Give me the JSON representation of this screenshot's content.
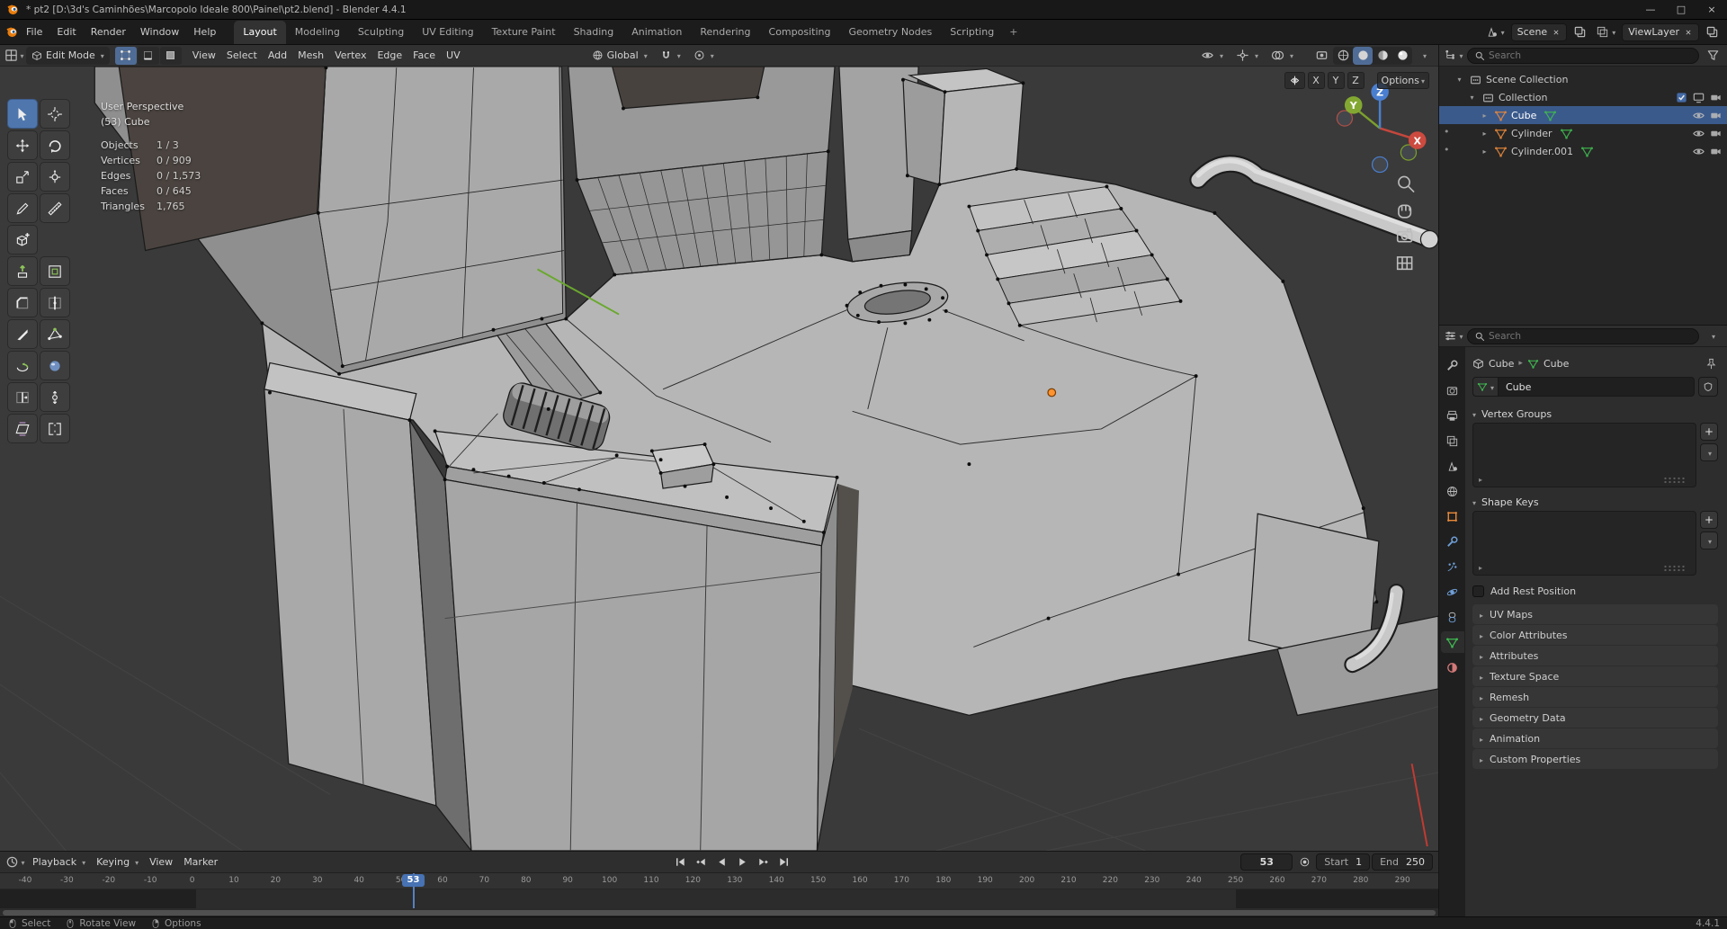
{
  "window": {
    "title": "* pt2 [D:\\3d's Caminhões\\Marcopolo Ideale 800\\Painel\\pt2.blend] - Blender 4.4.1"
  },
  "colors": {
    "accent": "#4772b3",
    "selection_row": "#3b5a8c",
    "object_orange": "#e8883a",
    "mesh_green": "#3fb950",
    "axis_x": "#c4473d",
    "axis_y": "#6fa21c",
    "axis_z": "#3d6fd2"
  },
  "topbar": {
    "menus": [
      {
        "label": "File"
      },
      {
        "label": "Edit"
      },
      {
        "label": "Render"
      },
      {
        "label": "Window"
      },
      {
        "label": "Help"
      }
    ],
    "workspaces": [
      {
        "label": "Layout",
        "active": true
      },
      {
        "label": "Modeling"
      },
      {
        "label": "Sculpting"
      },
      {
        "label": "UV Editing"
      },
      {
        "label": "Texture Paint"
      },
      {
        "label": "Shading"
      },
      {
        "label": "Animation"
      },
      {
        "label": "Rendering"
      },
      {
        "label": "Compositing"
      },
      {
        "label": "Geometry Nodes"
      },
      {
        "label": "Scripting"
      }
    ],
    "add_tab": "+",
    "scene": {
      "value": "Scene"
    },
    "viewlayer": {
      "value": "ViewLayer"
    }
  },
  "viewport": {
    "header": {
      "mode": "Edit Mode",
      "menus": [
        {
          "label": "View"
        },
        {
          "label": "Select"
        },
        {
          "label": "Add"
        },
        {
          "label": "Mesh"
        },
        {
          "label": "Vertex"
        },
        {
          "label": "Edge"
        },
        {
          "label": "Face"
        },
        {
          "label": "UV"
        }
      ],
      "orientation": "Global"
    },
    "overlay_region": {
      "mirror_x": "X",
      "mirror_y": "Y",
      "mirror_z": "Z",
      "options": "Options"
    },
    "text_overlay": {
      "perspective": "User Perspective",
      "active_object": "(53) Cube",
      "stats": [
        {
          "label": "Objects",
          "value": "1 / 3"
        },
        {
          "label": "Vertices",
          "value": "0 / 909"
        },
        {
          "label": "Edges",
          "value": "0 / 1,573"
        },
        {
          "label": "Faces",
          "value": "0 / 645"
        },
        {
          "label": "Triangles",
          "value": "1,765"
        }
      ]
    },
    "toolbar": [
      {
        "name": "tweak",
        "icon": "tool-tweak",
        "active": true
      },
      {
        "name": "cursor",
        "icon": "tool-cursor"
      },
      {
        "name": "move",
        "icon": "tool-move"
      },
      {
        "name": "rotate",
        "icon": "tool-rotate"
      },
      {
        "name": "scale",
        "icon": "tool-scale"
      },
      {
        "name": "transform",
        "icon": "tool-transform"
      },
      {
        "name": "annotate",
        "icon": "tool-annotate"
      },
      {
        "name": "measure",
        "icon": "tool-measure"
      },
      {
        "name": "add-cube",
        "icon": "tool-addcube"
      },
      {
        "empty": true
      },
      {
        "name": "extrude-region",
        "icon": "tool-extrude"
      },
      {
        "name": "inset-faces",
        "icon": "tool-inset"
      },
      {
        "name": "bevel",
        "icon": "tool-bevel"
      },
      {
        "name": "loop-cut",
        "icon": "tool-loopcut"
      },
      {
        "name": "knife",
        "icon": "tool-knife"
      },
      {
        "name": "poly-build",
        "icon": "tool-polybuild"
      },
      {
        "name": "spin",
        "icon": "tool-spin"
      },
      {
        "name": "smooth",
        "icon": "tool-smooth"
      },
      {
        "name": "edge-slide",
        "icon": "tool-edgeslide"
      },
      {
        "name": "shrink-fatten",
        "icon": "tool-shrink"
      },
      {
        "name": "shear",
        "icon": "tool-shear"
      },
      {
        "name": "rip-region",
        "icon": "tool-rip"
      }
    ],
    "gizmo": {
      "x": "X",
      "y": "Y",
      "z": "Z"
    }
  },
  "outliner": {
    "search_placeholder": "Search",
    "rows": [
      {
        "label": "Scene Collection",
        "level": 0,
        "icon": "collection",
        "disclosure": "▾"
      },
      {
        "label": "Collection",
        "level": 1,
        "icon": "collection",
        "disclosure": "▾",
        "chk": true,
        "screen": true,
        "cam": true
      },
      {
        "label": "Cube",
        "level": 2,
        "icon": "mesh-obj",
        "disclosure": "▸",
        "selected": true,
        "data_icon": true,
        "eye": true,
        "cam": true
      },
      {
        "label": "Cylinder",
        "level": 2,
        "icon": "mesh-obj",
        "disclosure": "▸",
        "dot": true,
        "data_icon": true,
        "eye": true,
        "cam": true
      },
      {
        "label": "Cylinder.001",
        "level": 2,
        "icon": "mesh-obj",
        "disclosure": "▸",
        "dot": true,
        "data_icon": true,
        "eye": true,
        "cam": true
      }
    ]
  },
  "properties": {
    "search_placeholder": "Search",
    "tabs": [
      {
        "name": "tool",
        "icon": "tab-tool"
      },
      {
        "name": "render",
        "icon": "tab-render"
      },
      {
        "name": "output",
        "icon": "tab-output"
      },
      {
        "name": "view-layer",
        "icon": "tab-viewlayer"
      },
      {
        "name": "scene",
        "icon": "tab-scene"
      },
      {
        "name": "world",
        "icon": "tab-world"
      },
      {
        "name": "object",
        "icon": "tab-object"
      },
      {
        "name": "modifiers",
        "icon": "tab-modifier"
      },
      {
        "name": "particles",
        "icon": "tab-particles"
      },
      {
        "name": "physics",
        "icon": "tab-physics"
      },
      {
        "name": "constraints",
        "icon": "tab-constraints"
      },
      {
        "name": "object-data",
        "icon": "tab-data",
        "active": true
      },
      {
        "name": "material",
        "icon": "tab-material"
      }
    ],
    "breadcrumb": {
      "object": "Cube",
      "data": "Cube"
    },
    "name_field": "Cube",
    "panels": [
      {
        "label": "Vertex Groups",
        "list": true
      },
      {
        "label": "Shape Keys",
        "list": true
      },
      {
        "label": "Add Rest Position",
        "checkbox": true
      },
      {
        "label": "UV Maps",
        "collapsed": true
      },
      {
        "label": "Color Attributes",
        "collapsed": true
      },
      {
        "label": "Attributes",
        "collapsed": true
      },
      {
        "label": "Texture Space",
        "collapsed": true
      },
      {
        "label": "Remesh",
        "collapsed": true
      },
      {
        "label": "Geometry Data",
        "collapsed": true
      },
      {
        "label": "Animation",
        "collapsed": true
      },
      {
        "label": "Custom Properties",
        "collapsed": true
      }
    ]
  },
  "timeline": {
    "menus": [
      {
        "label": "Playback",
        "chev": true
      },
      {
        "label": "Keying",
        "chev": true
      },
      {
        "label": "View"
      },
      {
        "label": "Marker"
      }
    ],
    "current_frame": "53",
    "playhead_frame": 53,
    "start_label": "Start",
    "start_value": "1",
    "end_label": "End",
    "end_value": "250",
    "ticks": [
      "-40",
      "-30",
      "-20",
      "-10",
      "0",
      "10",
      "20",
      "30",
      "40",
      "50",
      "60",
      "70",
      "80",
      "90",
      "100",
      "110",
      "120",
      "130",
      "140",
      "150",
      "160",
      "170",
      "180",
      "190",
      "200",
      "210",
      "220",
      "230",
      "240",
      "250",
      "260",
      "270",
      "280",
      "290"
    ]
  },
  "statusbar": {
    "items": [
      {
        "icon": "mouse-left",
        "label": "Select"
      },
      {
        "icon": "mouse-middle",
        "label": "Rotate View"
      },
      {
        "icon": "mouse-right",
        "label": "Options"
      }
    ],
    "version": "4.4.1"
  }
}
